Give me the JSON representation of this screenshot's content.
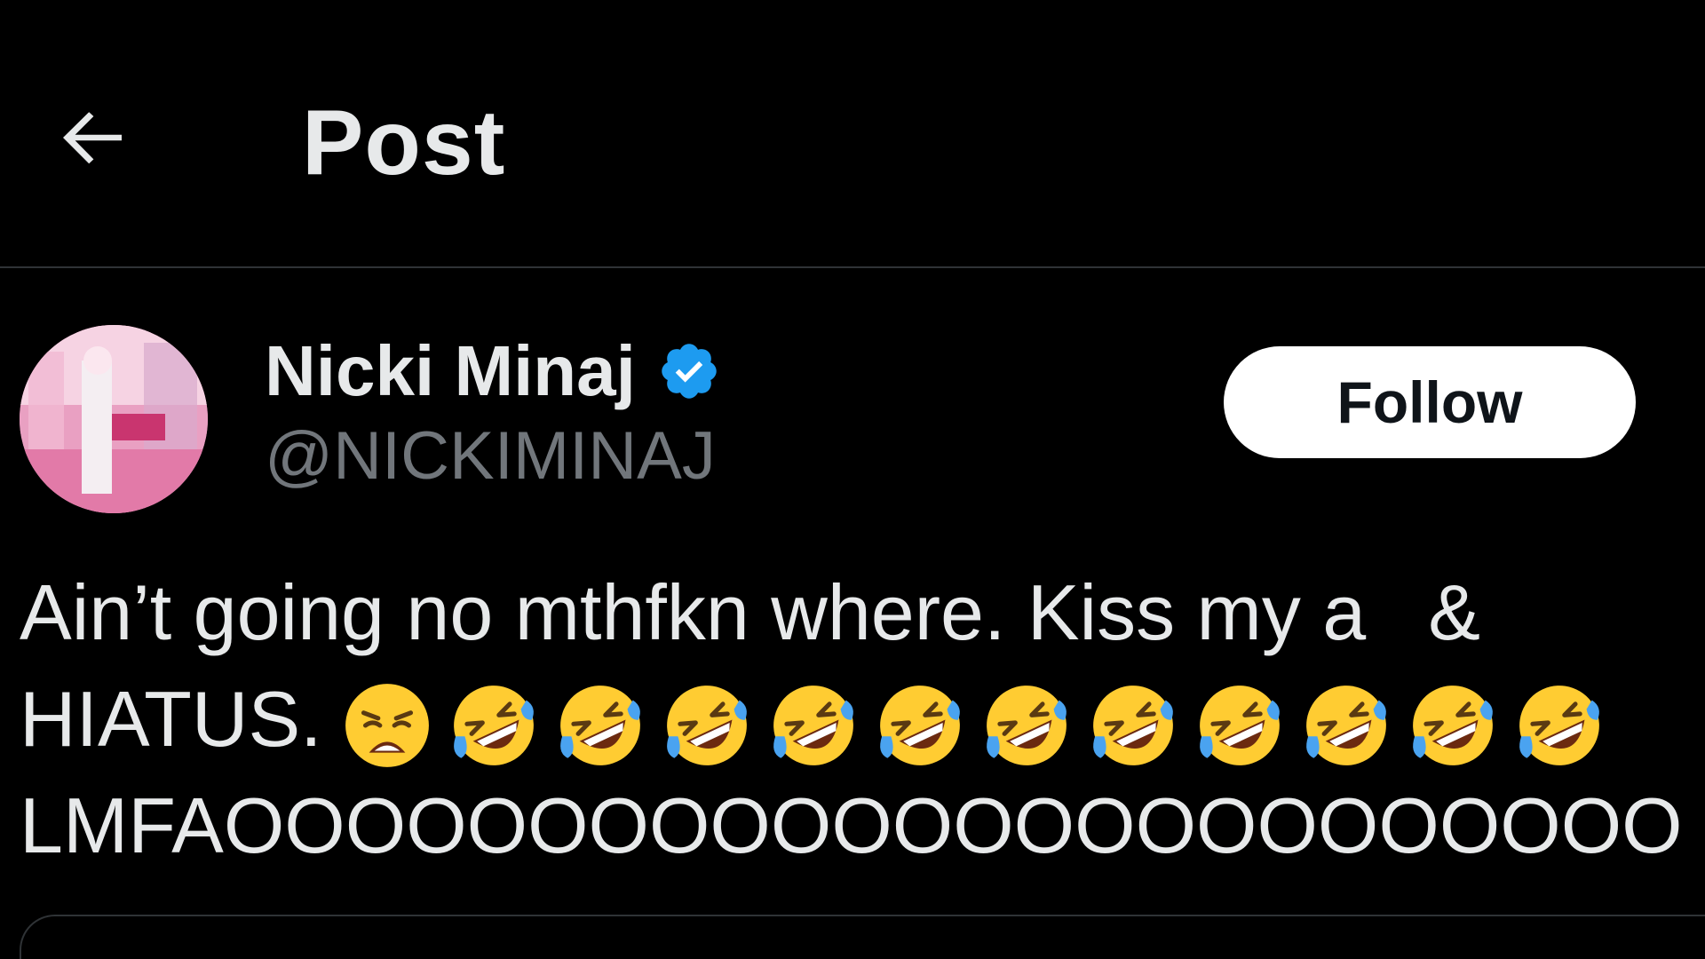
{
  "header": {
    "back_icon": "arrow-left-icon",
    "title": "Post"
  },
  "author": {
    "avatar_icon": "avatar",
    "display_name": "Nicki Minaj",
    "verified_icon": "verified-badge-icon",
    "verified_color": "#1d9bf0",
    "handle": "@NICKIMINAJ"
  },
  "follow_button": {
    "label": "Follow"
  },
  "post": {
    "line1_part1": "Ain’t going no mthfkn where. Kiss my a",
    "line1_part2": "&",
    "line2_text": "HIATUS.",
    "line2_emojis": [
      "weary-face-icon",
      "rolling-on-floor-laughing-icon",
      "rolling-on-floor-laughing-icon",
      "rolling-on-floor-laughing-icon",
      "rolling-on-floor-laughing-icon",
      "rolling-on-floor-laughing-icon",
      "rolling-on-floor-laughing-icon",
      "rolling-on-floor-laughing-icon",
      "rolling-on-floor-laughing-icon",
      "rolling-on-floor-laughing-icon",
      "rolling-on-floor-laughing-icon",
      "rolling-on-floor-laughing-icon"
    ],
    "line3": "LMFAOOOOOOOOOOOOOOOOOOOOOOOO"
  },
  "colors": {
    "background": "#000000",
    "text": "#e7e9ea",
    "secondary_text": "#71767b",
    "divider": "#2f3336",
    "follow_bg": "#ffffff",
    "follow_text": "#0f1419"
  }
}
